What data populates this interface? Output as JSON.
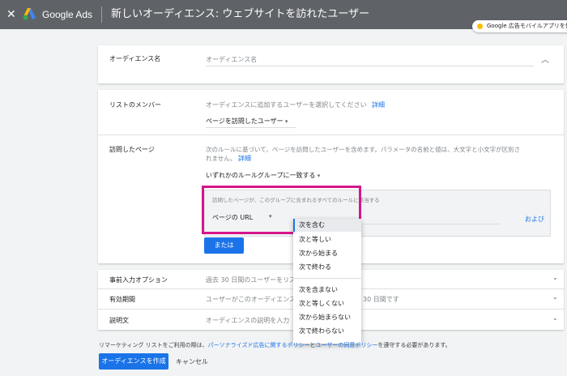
{
  "header": {
    "close_glyph": "✕",
    "brand": "Google Ads",
    "page_title": "新しいオーディエンス: ウェブサイトを訪れたユーザー",
    "promo_text": "Google 広告モバイルアプリを使う"
  },
  "audience_name": {
    "label": "オーディエンス名",
    "placeholder": "オーディエンス名"
  },
  "list_members": {
    "label": "リストのメンバー",
    "description": "オーディエンスに追加するユーザーを選択してください",
    "details_link": "詳細",
    "selected": "ページを訪問したユーザー"
  },
  "visited_pages": {
    "label": "訪問したページ",
    "description_line1": "次のルールに基づいて、ページを訪問したユーザーを含めます。パラメータの名前と値は、大文字と小文字が区別さ",
    "description_line2": "れません。",
    "details_link": "詳細",
    "rule_group_select": "いずれかのルールグループに一致する",
    "group_header": "訪問したページが、このグループに含まれるすべてのルールに該当する",
    "field_select": "ページの URL",
    "and_link": "および",
    "or_button": "または"
  },
  "operator_menu": {
    "items_positive": [
      "次を含む",
      "次と等しい",
      "次から始まる",
      "次で終わる"
    ],
    "items_negative": [
      "次を含まない",
      "次と等しくない",
      "次から始まらない",
      "次で終わらない"
    ],
    "selected": "次を含む"
  },
  "prefill": {
    "label": "事前入力オプション",
    "value": "過去 30 日間のユーザーをリス"
  },
  "duration": {
    "label": "有効期間",
    "value_left": "ユーザーがこのオーディエンス",
    "value_right": "30 日間です"
  },
  "description_row": {
    "label": "説明文",
    "value": "オーディエンスの説明を入力"
  },
  "footer": {
    "text_before": "リマーケティング リストをご利用の際は、",
    "policy_link": "パーソナライズド広告に関するポリシー",
    "text_mid": "と",
    "consent_link": "ユーザーの同意ポリシー",
    "text_after": "を遵守する必要があります。",
    "create_button": "オーディエンスを作成",
    "cancel_button": "キャンセル"
  },
  "colors": {
    "accent": "#1a73e8",
    "highlight": "#d6168b",
    "topbar": "#5f6368"
  }
}
